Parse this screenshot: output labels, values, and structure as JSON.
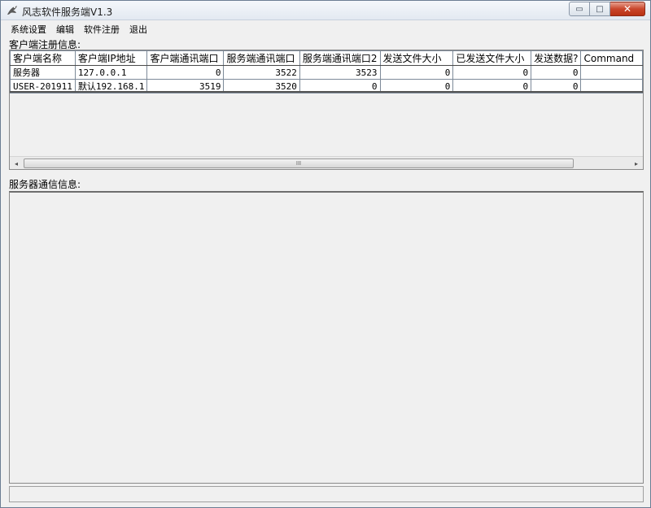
{
  "window": {
    "title": "风志软件服务端V1.3",
    "controls": {
      "minimize": "▭",
      "maximize": "□",
      "close": "✕"
    }
  },
  "menu": [
    "系统设置",
    "编辑",
    "软件注册",
    "退出"
  ],
  "clients_section": {
    "label": "客户端注册信息:",
    "columns": [
      "客户端名称",
      "客户端IP地址",
      "客户端通讯端口",
      "服务端通讯端口",
      "服务端通讯端口2",
      "发送文件大小",
      "已发送文件大小",
      "发送数据?",
      "Command"
    ],
    "rows": [
      [
        "服务器",
        "127.0.0.1",
        "0",
        "3522",
        "3523",
        "0",
        "0",
        "0",
        ""
      ],
      [
        "USER-201911",
        "默认192.168.1",
        "3519",
        "3520",
        "0",
        "0",
        "0",
        "0",
        ""
      ]
    ],
    "scroll_thumb": "III"
  },
  "server_section": {
    "label": "服务器通信信息:"
  },
  "icons": {
    "app": "app-icon",
    "scroll_left": "◂",
    "scroll_right": "▸"
  }
}
